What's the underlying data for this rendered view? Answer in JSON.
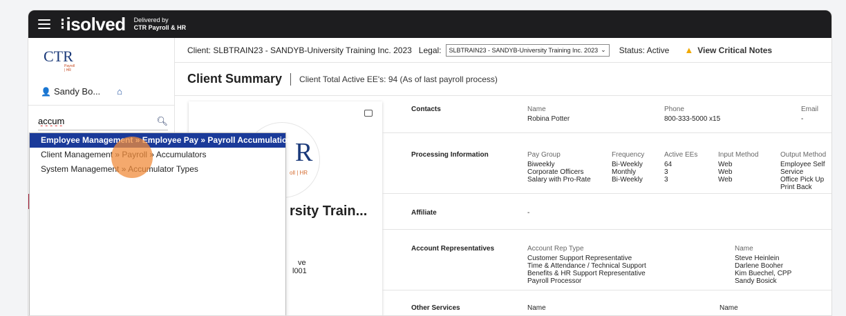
{
  "topbar": {
    "logo": "isolved",
    "delivered_line1": "Delivered by",
    "delivered_line2": "CTR Payroll & HR"
  },
  "sidebar": {
    "ctr_logo": "CTR",
    "ctr_sub": "Payroll | HR",
    "user_name": "Sandy Bo...",
    "search_value": "accum"
  },
  "dropdown": {
    "items": [
      "Employee Management » Employee Pay » Payroll Accumulations",
      "Client Management » Payroll » Accumulators",
      "System Management » Accumulator Types"
    ]
  },
  "clientbar": {
    "client": "Client: SLBTRAIN23 - SANDYB-University Training Inc. 2023",
    "legal_label": "Legal:",
    "legal_value": "SLBTRAIN23 - SANDYB-University Training Inc. 2023",
    "status": "Status: Active",
    "critical_notes": "View Critical Notes"
  },
  "summary": {
    "title": "Client Summary",
    "subtitle": "Client Total Active EE's: 94 (As of last payroll process)"
  },
  "card": {
    "r_letter": "R",
    "r_sub": "oll | HR",
    "name_fragment": "rsity Train...",
    "line1": "ve",
    "line2": "l001"
  },
  "contacts": {
    "label": "Contacts",
    "name_hd": "Name",
    "name": "Robina Potter",
    "phone_hd": "Phone",
    "phone": "800-333-5000 x15",
    "email_hd": "Email",
    "email": "-"
  },
  "processing": {
    "label": "Processing Information",
    "headers": [
      "Pay Group",
      "Frequency",
      "Active EEs",
      "Input Method",
      "Output Method"
    ],
    "pay_group": [
      "Biweekly",
      "Corporate Officers",
      "Salary with Pro-Rate"
    ],
    "frequency": [
      "Bi-Weekly",
      "Monthly",
      "Bi-Weekly"
    ],
    "active": [
      "64",
      "3",
      "3"
    ],
    "input": [
      "Web",
      "Web",
      "Web"
    ],
    "output": [
      "Employee Self Service",
      "Office Pick Up",
      "Print Back"
    ]
  },
  "affiliate": {
    "label": "Affiliate",
    "value": "-"
  },
  "reps": {
    "label": "Account Representatives",
    "type_hd": "Account Rep Type",
    "types": [
      "Customer Support Representative",
      "Time & Attendance / Technical Support",
      "Benefits & HR Support Representative",
      "Payroll Processor"
    ],
    "name_hd": "Name",
    "names": [
      "Steve Heinlein",
      "Darlene Booher",
      "Kim Buechel, CPP",
      "Sandy Bosick"
    ]
  },
  "other": {
    "label": "Other Services",
    "name_hd1": "Name",
    "name_hd2": "Name"
  }
}
